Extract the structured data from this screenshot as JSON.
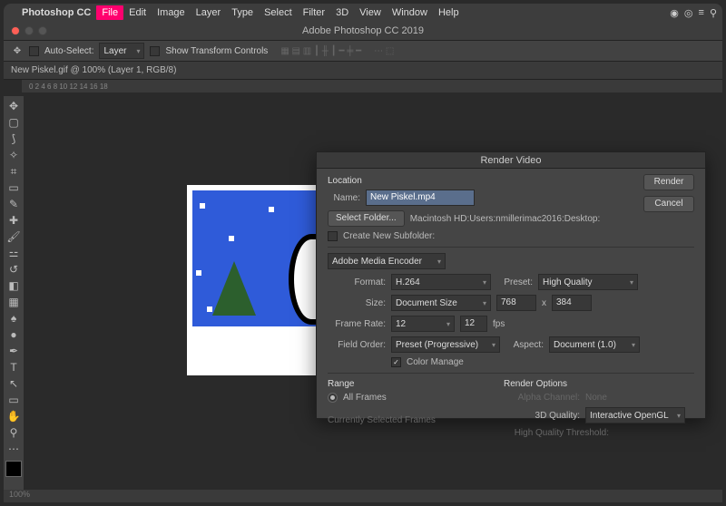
{
  "menubar": {
    "app": "Photoshop CC",
    "items": [
      "File",
      "Edit",
      "Image",
      "Layer",
      "Type",
      "Select",
      "Filter",
      "3D",
      "View",
      "Window",
      "Help"
    ],
    "highlighted": "File"
  },
  "window_title": "Adobe Photoshop CC 2019",
  "options": {
    "auto_select": "Auto-Select:",
    "layer": "Layer",
    "show_transform": "Show Transform Controls"
  },
  "document_tab": "New Piskel.gif @ 100% (Layer 1, RGB/8)",
  "ruler": "0        2        4        6        8        10        12        14        16        18",
  "dialog": {
    "title": "Render Video",
    "location_label": "Location",
    "name_label": "Name:",
    "name_value": "New Piskel.mp4",
    "select_folder_btn": "Select Folder...",
    "folder_path": "Macintosh HD:Users:nmillerimac2016:Desktop:",
    "create_subfolder": "Create New Subfolder:",
    "encoder": "Adobe Media Encoder",
    "format_label": "Format:",
    "format_value": "H.264",
    "preset_label": "Preset:",
    "preset_value": "High Quality",
    "size_label": "Size:",
    "size_value": "Document Size",
    "size_w": "768",
    "size_h": "384",
    "frame_rate_label": "Frame Rate:",
    "frame_rate_sel": "12",
    "frame_rate_num": "12",
    "fps": "fps",
    "field_order_label": "Field Order:",
    "field_order_value": "Preset (Progressive)",
    "aspect_label": "Aspect:",
    "aspect_value": "Document (1.0)",
    "color_manage": "Color Manage",
    "range_label": "Range",
    "all_frames": "All Frames",
    "currently_selected": "Currently Selected Frames",
    "render_options_label": "Render Options",
    "alpha_label": "Alpha Channel:",
    "alpha_value": "None",
    "quality_label": "3D Quality:",
    "quality_value": "Interactive OpenGL",
    "hq_threshold": "High Quality Threshold:",
    "render_btn": "Render",
    "cancel_btn": "Cancel"
  },
  "status": "100%"
}
